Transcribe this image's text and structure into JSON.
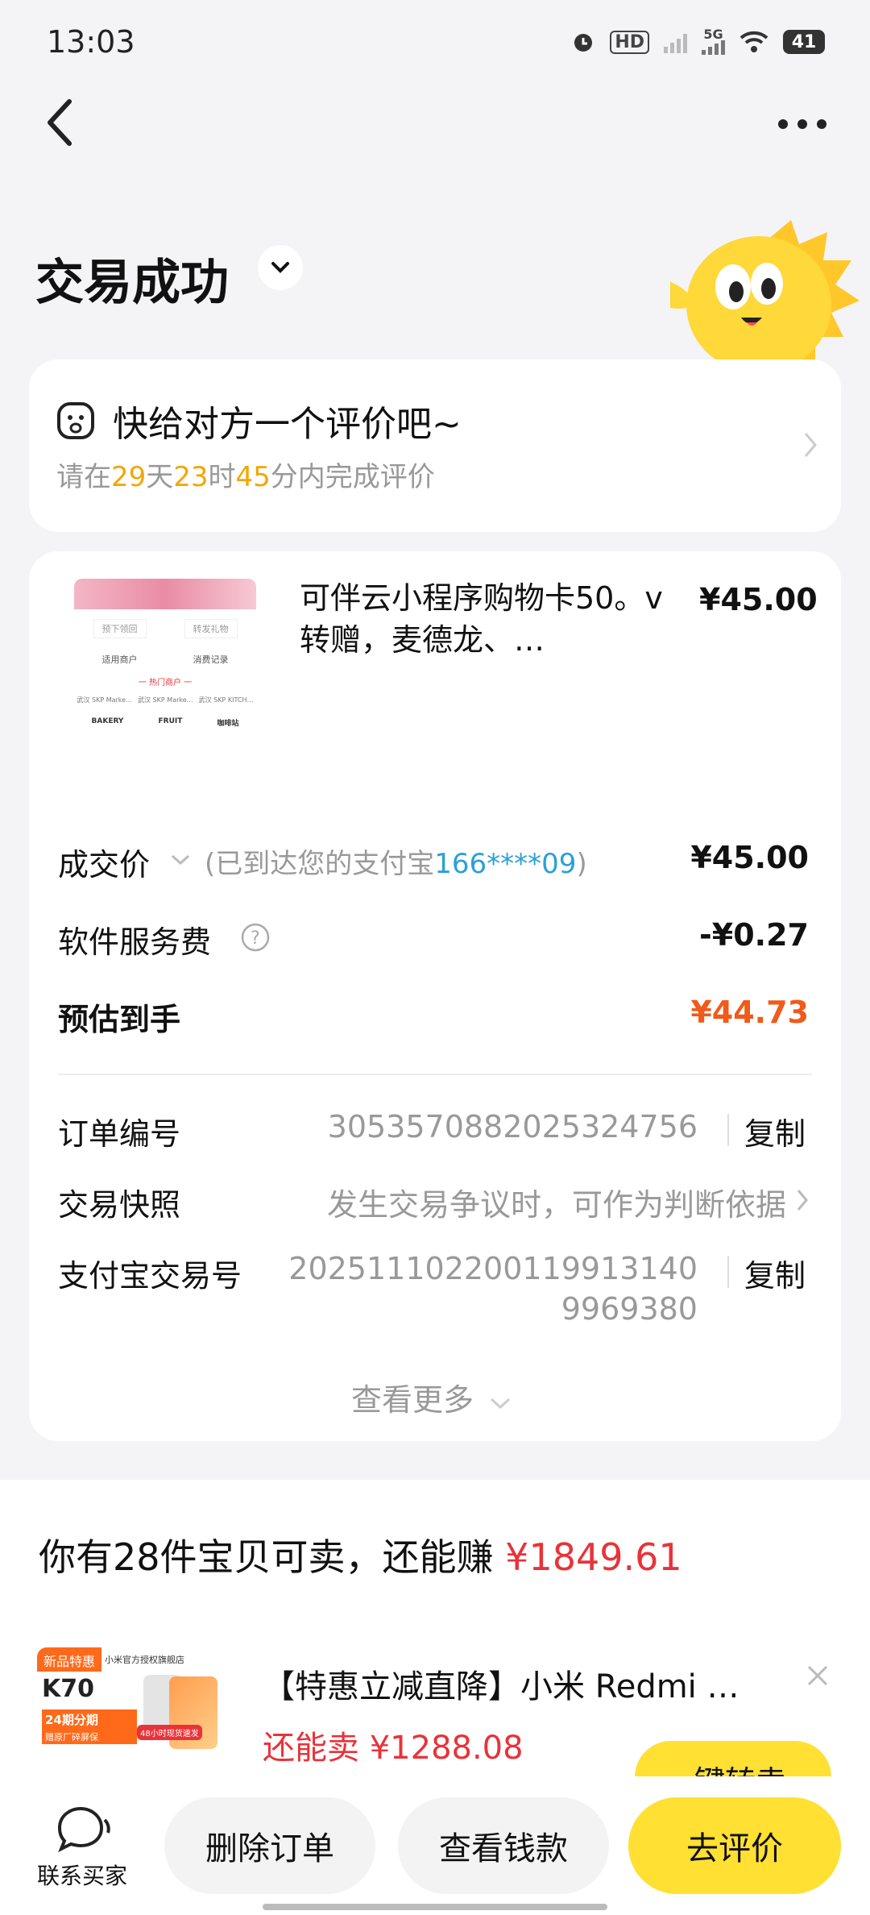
{
  "status_bar": {
    "time": "13:03",
    "battery": "41",
    "network": "5G",
    "hd": "HD"
  },
  "header": {
    "title": "交易成功"
  },
  "review_card": {
    "title": "快给对方一个评价吧~",
    "prefix": "请在",
    "days": "29",
    "days_unit": "天",
    "hours": "23",
    "hours_unit": "时",
    "minutes": "45",
    "suffix": "分内完成评价"
  },
  "product": {
    "title": "可伴云小程序购物卡50。v转赠，麦德龙、…",
    "price": "¥45.00",
    "thumb": {
      "btn1": "预下领回",
      "btn2": "转发礼物",
      "tab1": "适用商户",
      "tab2": "消费记录",
      "section": "一 热门商户 一",
      "stores": [
        "武汉 SKP Marke…",
        "武汉 SKP Marke…",
        "武汉 SKP KITCH…"
      ],
      "brands": [
        "BAKERY",
        "FRUIT",
        "咖啡站"
      ]
    }
  },
  "amounts": {
    "deal_label": "成交价",
    "deal_note_prefix": "(已到达您的支付宝",
    "deal_note_account": "166****09",
    "deal_note_suffix": ")",
    "deal_value": "¥45.00",
    "fee_label": "软件服务费",
    "fee_value": "-¥0.27",
    "net_label": "预估到手",
    "net_value": "¥44.73"
  },
  "order_info": {
    "order_no_label": "订单编号",
    "order_no": "3053570882025324756",
    "copy_label": "复制",
    "snapshot_label": "交易快照",
    "snapshot_text": "发生交易争议时，可作为判断依据",
    "alipay_label": "支付宝交易号",
    "alipay_no_line1": "20251110220011991314​0",
    "alipay_no_line2": "9969380",
    "copy_label2": "复制",
    "see_more": "查看更多"
  },
  "sell_section": {
    "prefix": "你有28件宝贝可卖，还能赚",
    "amount": "¥1849.61"
  },
  "ad": {
    "title": "【特惠立减直降】小米 Redmi …",
    "price_label": "还能卖",
    "price": "¥1288.08",
    "button": "一键转卖",
    "img_tag": "新品特惠",
    "img_model": "K70",
    "img_store": "小米官方授权旗舰店",
    "img_promo1": "24期分期",
    "img_promo2": "赠原厂碎屏保",
    "img_promo3": "48小时现货速发"
  },
  "bottom_bar": {
    "contact": "联系买家",
    "delete": "删除订单",
    "view_money": "查看钱款",
    "review": "去评价"
  },
  "colors": {
    "accent_yellow": "#ffe033",
    "orange": "#f5a600",
    "red": "#e8333a",
    "net_orange": "#f05a1a",
    "blue": "#2aa0d8"
  }
}
